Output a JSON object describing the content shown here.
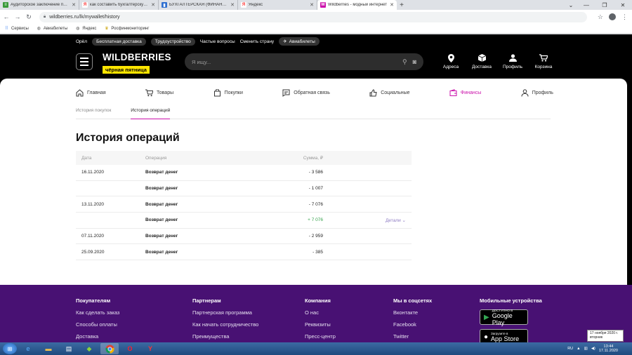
{
  "browser": {
    "tabs": [
      {
        "title": "Аудиторское заключение при с",
        "favicon": "green-doc",
        "color": "#3a9a3a"
      },
      {
        "title": "как составить бухгалтерскую о",
        "favicon": "yandex",
        "color": "#ff3333"
      },
      {
        "title": "БУХГАЛТЕРСКАЯ (ФИНАНСОВАЯ",
        "favicon": "blue-book",
        "color": "#2e6fd0"
      },
      {
        "title": "Яндекс",
        "favicon": "yandex",
        "color": "#ff3333"
      },
      {
        "title": "Wildberries - модный интернет",
        "favicon": "wildberries",
        "color": "#cb11ab"
      }
    ],
    "active_tab": 4,
    "url": "wildberries.ru/lk/mywallet/history",
    "bookmarks": [
      {
        "label": "Сервисы",
        "icon": "apps-icon"
      },
      {
        "label": "Авиабилеты",
        "icon": "globe-icon"
      },
      {
        "label": "Яндекс",
        "icon": "globe-icon"
      },
      {
        "label": "Росфинмониторинг",
        "icon": "emblem-icon"
      }
    ]
  },
  "site": {
    "topbar": {
      "city": "Орёл",
      "free_delivery": "Бесплатная доставка",
      "jobs": "Трудоустройство",
      "faq": "Частые вопросы",
      "country": "Сменить страну",
      "avia": "Авиабилеты"
    },
    "logo": {
      "name": "WILDBERRIES",
      "promo": "чёрная пятница"
    },
    "search_placeholder": "Я ищу...",
    "header_icons": [
      {
        "label": "Адреса",
        "icon": "pin-icon"
      },
      {
        "label": "Доставка",
        "icon": "box-icon"
      },
      {
        "label": "Профиль",
        "icon": "user-icon"
      },
      {
        "label": "Корзина",
        "icon": "cart-icon"
      }
    ],
    "main_nav": [
      {
        "label": "Главная",
        "icon": "home-icon"
      },
      {
        "label": "Товары",
        "icon": "cart-icon"
      },
      {
        "label": "Покупки",
        "icon": "bag-icon"
      },
      {
        "label": "Обратная связь",
        "icon": "feedback-icon"
      },
      {
        "label": "Социальные",
        "icon": "like-icon"
      },
      {
        "label": "Финансы",
        "icon": "wallet-icon"
      },
      {
        "label": "Профиль",
        "icon": "user-icon"
      }
    ],
    "active_nav": "Финансы",
    "sub_nav": [
      {
        "label": "История покупок"
      },
      {
        "label": "История операций"
      }
    ],
    "page_title": "История операций",
    "table": {
      "headers": {
        "date": "Дата",
        "operation": "Операция",
        "amount": "Сумма, ₽"
      },
      "rows": [
        {
          "date": "16.11.2020",
          "operation": "Возврат денег",
          "amount": "- 3 586",
          "details": ""
        },
        {
          "date": "",
          "operation": "Возврат денег",
          "amount": "- 1 007",
          "details": ""
        },
        {
          "date": "13.11.2020",
          "operation": "Возврат денег",
          "amount": "- 7 076",
          "details": ""
        },
        {
          "date": "",
          "operation": "Возврат денег",
          "amount": "+ 7 076",
          "details": "Детали"
        },
        {
          "date": "07.11.2020",
          "operation": "Возврат денег",
          "amount": "- 2 959",
          "details": ""
        },
        {
          "date": "25.09.2020",
          "operation": "Возврат денег",
          "amount": "- 385",
          "details": ""
        }
      ]
    },
    "footer": {
      "buyers": {
        "title": "Покупателям",
        "links": [
          "Как сделать заказ",
          "Способы оплаты",
          "Доставка"
        ]
      },
      "partners": {
        "title": "Партнерам",
        "links": [
          "Партнерская программа",
          "Как начать сотрудничество",
          "Преимущества"
        ]
      },
      "company": {
        "title": "Компания",
        "links": [
          "О нас",
          "Реквизиты",
          "Пресс-центр"
        ]
      },
      "social": {
        "title": "Мы в соцсетях",
        "links": [
          "Вконтакте",
          "Facebook",
          "Twitter"
        ]
      },
      "mobile": {
        "title": "Мобильные устройства",
        "google_small": "ДОСТУПНО В",
        "google_big": "Google Play",
        "apple_small": "Загрузите в",
        "apple_big": "App Store"
      }
    }
  },
  "taskbar": {
    "lang": "RU",
    "time": "13:44",
    "date": "17.11.2020",
    "tooltip_line1": "17 ноября 2020 г.",
    "tooltip_line2": "вторник"
  },
  "colors": {
    "brand": "#cb11ab",
    "footer": "#481173",
    "positive": "#33a14a"
  }
}
